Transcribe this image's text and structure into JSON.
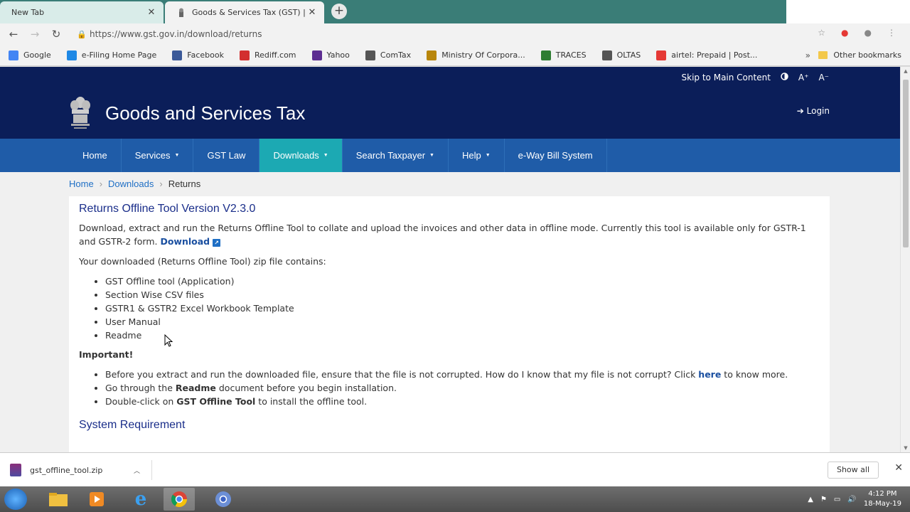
{
  "browser": {
    "tabs": [
      {
        "title": "New Tab",
        "active": false
      },
      {
        "title": "Goods & Services Tax (GST) | Ret",
        "active": true
      }
    ],
    "url": "https://www.gst.gov.in/download/returns",
    "bookmarks": [
      {
        "label": "Google",
        "icon": "google-icon",
        "color": "#4285f4"
      },
      {
        "label": "e-Filing Home Page",
        "icon": "ie-icon",
        "color": "#1e88e5"
      },
      {
        "label": "Facebook",
        "icon": "facebook-icon",
        "color": "#3b5998"
      },
      {
        "label": "Rediff.com",
        "icon": "rediff-icon",
        "color": "#d32f2f"
      },
      {
        "label": "Yahoo",
        "icon": "yahoo-icon",
        "color": "#5c2d91"
      },
      {
        "label": "ComTax",
        "icon": "globe-icon",
        "color": "#555555"
      },
      {
        "label": "Ministry Of Corpora...",
        "icon": "emblem-icon",
        "color": "#b8860b"
      },
      {
        "label": "TRACES",
        "icon": "traces-icon",
        "color": "#2e7d32"
      },
      {
        "label": "OLTAS",
        "icon": "globe-icon",
        "color": "#555555"
      },
      {
        "label": "airtel: Prepaid | Post...",
        "icon": "airtel-icon",
        "color": "#e53935"
      }
    ],
    "more_bookmarks": "»",
    "other_bookmarks": "Other bookmarks"
  },
  "header": {
    "skip_link": "Skip to Main Content",
    "contrast_icon": "contrast-icon",
    "font_increase": "A⁺",
    "font_decrease": "A⁻",
    "site_title": "Goods and Services Tax",
    "login": "Login"
  },
  "nav": {
    "items": [
      {
        "label": "Home",
        "dropdown": false,
        "active": false
      },
      {
        "label": "Services",
        "dropdown": true,
        "active": false
      },
      {
        "label": "GST Law",
        "dropdown": false,
        "active": false
      },
      {
        "label": "Downloads",
        "dropdown": true,
        "active": true
      },
      {
        "label": "Search Taxpayer",
        "dropdown": true,
        "active": false
      },
      {
        "label": "Help",
        "dropdown": true,
        "active": false
      },
      {
        "label": "e-Way Bill System",
        "dropdown": false,
        "active": false
      }
    ]
  },
  "breadcrumb": {
    "home": "Home",
    "downloads": "Downloads",
    "current": "Returns",
    "separator": "›"
  },
  "content": {
    "heading": "Returns Offline Tool Version V2.3.0",
    "intro": "Download, extract and run the Returns Offline Tool to collate and upload the invoices and other data in offline mode. Currently this tool is available only for GSTR-1 and GSTR-2 form.",
    "download_link": "Download",
    "zip_intro": "Your downloaded (Returns Offline Tool) zip file contains:",
    "zip_contents": [
      "GST Offline tool (Application)",
      "Section Wise CSV files",
      "GSTR1 & GSTR2 Excel Workbook Template",
      "User Manual",
      "Readme"
    ],
    "important_label": "Important!",
    "important": {
      "item1_before": "Before you extract and run the downloaded file, ensure that the file is not corrupted. How do I know that my file is not corrupt? Click ",
      "item1_link": "here",
      "item1_after": " to know more.",
      "item2_before": "Go through the ",
      "item2_bold": "Readme",
      "item2_after": " document before you begin installation.",
      "item3_before": "Double-click on ",
      "item3_bold": "GST Offline Tool",
      "item3_after": " to install the offline tool."
    },
    "next_heading": "System Requirement"
  },
  "downloads_shelf": {
    "file": "gst_offline_tool.zip",
    "show_all": "Show all"
  },
  "taskbar": {
    "time": "4:12 PM",
    "date": "18-May-19"
  }
}
